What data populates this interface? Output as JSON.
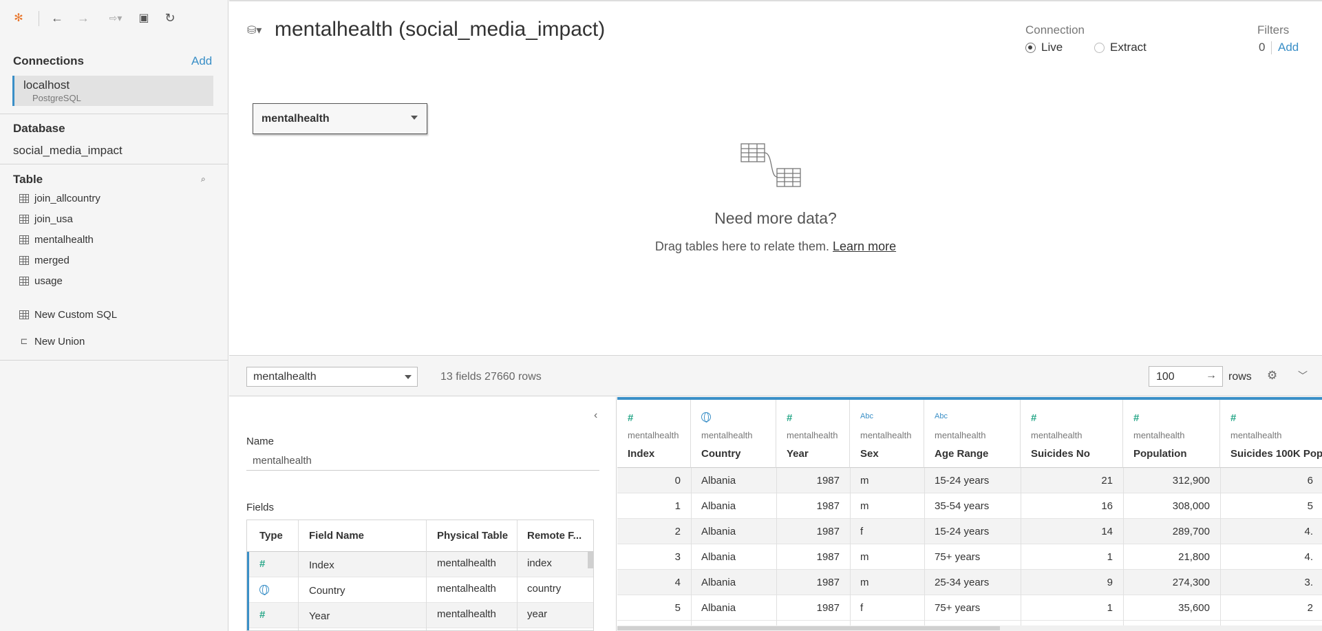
{
  "left_pane": {
    "connections_title": "Connections",
    "connections_add": "Add",
    "connection": {
      "name": "localhost",
      "type": "PostgreSQL"
    },
    "database_title": "Database",
    "database_name": "social_media_impact",
    "table_title": "Table",
    "tables": [
      {
        "label": "join_allcountry"
      },
      {
        "label": "join_usa"
      },
      {
        "label": "mentalhealth"
      },
      {
        "label": "merged"
      },
      {
        "label": "usage"
      }
    ],
    "custom_sql": "New Custom SQL",
    "new_union": "New Union"
  },
  "canvas": {
    "title": "mentalhealth (social_media_impact)",
    "connection_label": "Connection",
    "live_label": "Live",
    "extract_label": "Extract",
    "filters_label": "Filters",
    "filters_count": "0",
    "filters_add": "Add",
    "table_chip": "mentalhealth",
    "need_more": "Need more data?",
    "drag_hint": "Drag tables here to relate them. ",
    "learn_more": "Learn more"
  },
  "bottom_bar": {
    "table_select": "mentalhealth",
    "meta": "13 fields 27660 rows",
    "rows_value": "100",
    "rows_label": "rows"
  },
  "metadata": {
    "name_label": "Name",
    "name_value": "mentalhealth",
    "fields_label": "Fields",
    "headers": [
      "Type",
      "Field Name",
      "Physical Table",
      "Remote F..."
    ],
    "rows": [
      {
        "type": "number",
        "field": "Index",
        "table": "mentalhealth",
        "remote": "index"
      },
      {
        "type": "geo",
        "field": "Country",
        "table": "mentalhealth",
        "remote": "country"
      },
      {
        "type": "number",
        "field": "Year",
        "table": "mentalhealth",
        "remote": "year"
      }
    ]
  },
  "grid": {
    "columns": [
      {
        "type": "number",
        "source": "mentalhealth",
        "name": "Index"
      },
      {
        "type": "geo",
        "source": "mentalhealth",
        "name": "Country"
      },
      {
        "type": "number",
        "source": "mentalhealth",
        "name": "Year"
      },
      {
        "type": "string",
        "source": "mentalhealth",
        "name": "Sex"
      },
      {
        "type": "string",
        "source": "mentalhealth",
        "name": "Age Range"
      },
      {
        "type": "number",
        "source": "mentalhealth",
        "name": "Suicides No"
      },
      {
        "type": "number",
        "source": "mentalhealth",
        "name": "Population"
      },
      {
        "type": "number",
        "source": "mentalhealth",
        "name": "Suicides 100K Pop"
      }
    ],
    "rows": [
      [
        "0",
        "Albania",
        "1987",
        "m",
        "15-24 years",
        "21",
        "312,900",
        "6"
      ],
      [
        "1",
        "Albania",
        "1987",
        "m",
        "35-54 years",
        "16",
        "308,000",
        "5"
      ],
      [
        "2",
        "Albania",
        "1987",
        "f",
        "15-24 years",
        "14",
        "289,700",
        "4."
      ],
      [
        "3",
        "Albania",
        "1987",
        "m",
        "75+ years",
        "1",
        "21,800",
        "4."
      ],
      [
        "4",
        "Albania",
        "1987",
        "m",
        "25-34 years",
        "9",
        "274,300",
        "3."
      ],
      [
        "5",
        "Albania",
        "1987",
        "f",
        "75+ years",
        "1",
        "35,600",
        "2"
      ]
    ]
  },
  "icons": {
    "number": "#",
    "string": "Abc",
    "accent_color": "#3a8fc7",
    "number_color": "#2aa88a"
  }
}
